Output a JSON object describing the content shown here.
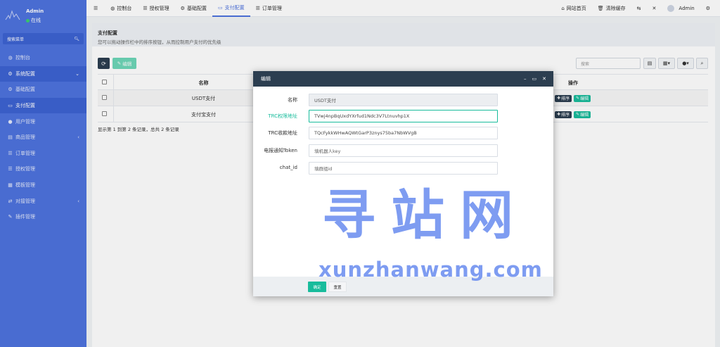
{
  "sidebar": {
    "admin_name": "Admin",
    "status": "在线",
    "search_placeholder": "搜索菜单",
    "items": [
      {
        "label": "控制台",
        "icon": "dashboard-icon",
        "glyph": "◍"
      },
      {
        "label": "系统配置",
        "icon": "gear-icon",
        "glyph": "⚙",
        "active": true,
        "arrow": "⌄"
      },
      {
        "label": "基础配置",
        "icon": "gear-icon",
        "glyph": "⚙"
      },
      {
        "label": "支付配置",
        "icon": "card-icon",
        "glyph": "▭",
        "active": true
      },
      {
        "label": "用户管理",
        "icon": "user-icon",
        "glyph": "●"
      },
      {
        "label": "商品管理",
        "icon": "box-icon",
        "glyph": "▤",
        "arrow": "‹"
      },
      {
        "label": "订单管理",
        "icon": "list-icon",
        "glyph": "☰"
      },
      {
        "label": "授权管理",
        "icon": "list-icon",
        "glyph": "☰"
      },
      {
        "label": "模板管理",
        "icon": "template-icon",
        "glyph": "▦"
      },
      {
        "label": "对接管理",
        "icon": "link-icon",
        "glyph": "⇄",
        "arrow": "‹"
      },
      {
        "label": "插件管理",
        "icon": "plugin-icon",
        "glyph": "✎"
      }
    ]
  },
  "topbar": {
    "menu_icon": "☰",
    "tabs": [
      {
        "label": "控制台",
        "icon": "dashboard-icon",
        "glyph": "◍"
      },
      {
        "label": "授权管理",
        "icon": "list-icon",
        "glyph": "☰"
      },
      {
        "label": "基础配置",
        "icon": "gear-icon",
        "glyph": "⚙"
      },
      {
        "label": "支付配置",
        "icon": "card-icon",
        "glyph": "▭",
        "active": true
      },
      {
        "label": "订单管理",
        "icon": "list-icon",
        "glyph": "☰"
      }
    ],
    "right": {
      "home": "网站首页",
      "clear_cache": "清除缓存",
      "user": "Admin"
    }
  },
  "page": {
    "title": "支付配置",
    "description": "您可以拖动操作栏中的排序按钮，从而控制用户支付的优先级"
  },
  "toolbar": {
    "edit_label": "编辑",
    "search_placeholder": "搜索"
  },
  "table": {
    "columns": [
      "名称",
      "操作"
    ],
    "rows": [
      {
        "name": "USDT支付",
        "sort": "排序",
        "edit": "编辑"
      },
      {
        "name": "支付宝支付",
        "sort": "排序",
        "edit": "编辑"
      }
    ],
    "info": "显示第 1 到第 2 条记录，总共 2 条记录"
  },
  "modal": {
    "title": "编辑",
    "fields": [
      {
        "label": "名称",
        "value": "USDT支付",
        "state": "disabled"
      },
      {
        "label": "TRC权限地址",
        "value": "TVwj4npBqUxdYXrfud1Ndc3V7Ltnuvhp1X",
        "state": "focus"
      },
      {
        "label": "TRC收款地址",
        "value": "TQcFykkWHwAQWtGarP3znys75ba7NbWVgB",
        "state": "normal"
      },
      {
        "label": "电报通知Token",
        "value": "填机器人key",
        "state": "placeholder"
      },
      {
        "label": "chat_id",
        "value": "填群组id",
        "state": "placeholder"
      }
    ],
    "ok_label": "确定",
    "reset_label": "重置"
  },
  "watermark": {
    "cn": "寻站网",
    "en": "xunzhanwang.com"
  },
  "colors": {
    "sidebar": "#4e73df",
    "header_dark": "#2c3e50",
    "accent_green": "#18bc9c",
    "watermark": "#6d8ff0"
  }
}
